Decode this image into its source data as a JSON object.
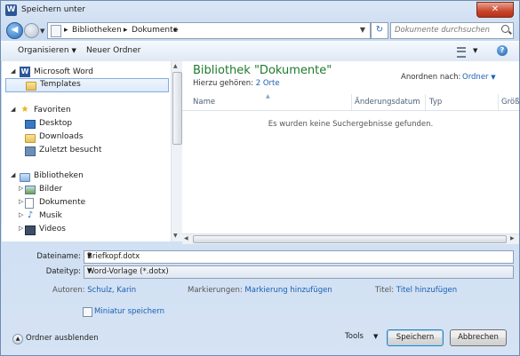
{
  "window": {
    "title": "Speichern unter",
    "app_icon": "W"
  },
  "address": {
    "breadcrumbs": [
      "Bibliotheken",
      "Dokumente"
    ],
    "search_placeholder": "Dokumente durchsuchen"
  },
  "toolbar": {
    "organize_label": "Organisieren",
    "new_folder_label": "Neuer Ordner"
  },
  "nav_tree": {
    "items": [
      {
        "label": "Microsoft Word",
        "icon": "word-icon"
      },
      {
        "label": "Templates",
        "icon": "folder-icon"
      },
      {
        "label": "Favoriten",
        "icon": "star-icon"
      },
      {
        "label": "Desktop",
        "icon": "desktop-icon"
      },
      {
        "label": "Downloads",
        "icon": "downloads-icon"
      },
      {
        "label": "Zuletzt besucht",
        "icon": "recent-icon"
      },
      {
        "label": "Bibliotheken",
        "icon": "libraries-icon"
      },
      {
        "label": "Bilder",
        "icon": "pictures-icon"
      },
      {
        "label": "Dokumente",
        "icon": "documents-icon"
      },
      {
        "label": "Musik",
        "icon": "music-icon"
      },
      {
        "label": "Videos",
        "icon": "videos-icon"
      }
    ]
  },
  "library": {
    "title": "Bibliothek \"Dokumente\"",
    "includes_label": "Hierzu gehören:",
    "includes_link": "2 Orte",
    "arrange_label": "Anordnen nach:",
    "arrange_value": "Ordner"
  },
  "columns": [
    "Name",
    "Änderungsdatum",
    "Typ",
    "Größe"
  ],
  "empty_message": "Es wurden keine Suchergebnisse gefunden.",
  "form": {
    "filename_label": "Dateiname:",
    "filename_value": "Briefkopf.dotx",
    "filetype_label": "Dateityp:",
    "filetype_value": "Word-Vorlage (*.dotx)",
    "authors_label": "Autoren:",
    "authors_value": "Schulz, Karin",
    "tags_label": "Markierungen:",
    "tags_value": "Markierung hinzufügen",
    "title_label": "Titel:",
    "title_value": "Titel hinzufügen",
    "thumbnail_label": "Miniatur speichern"
  },
  "footer": {
    "hide_folders": "Ordner ausblenden",
    "tools": "Tools",
    "save": "Speichern",
    "cancel": "Abbrechen"
  }
}
